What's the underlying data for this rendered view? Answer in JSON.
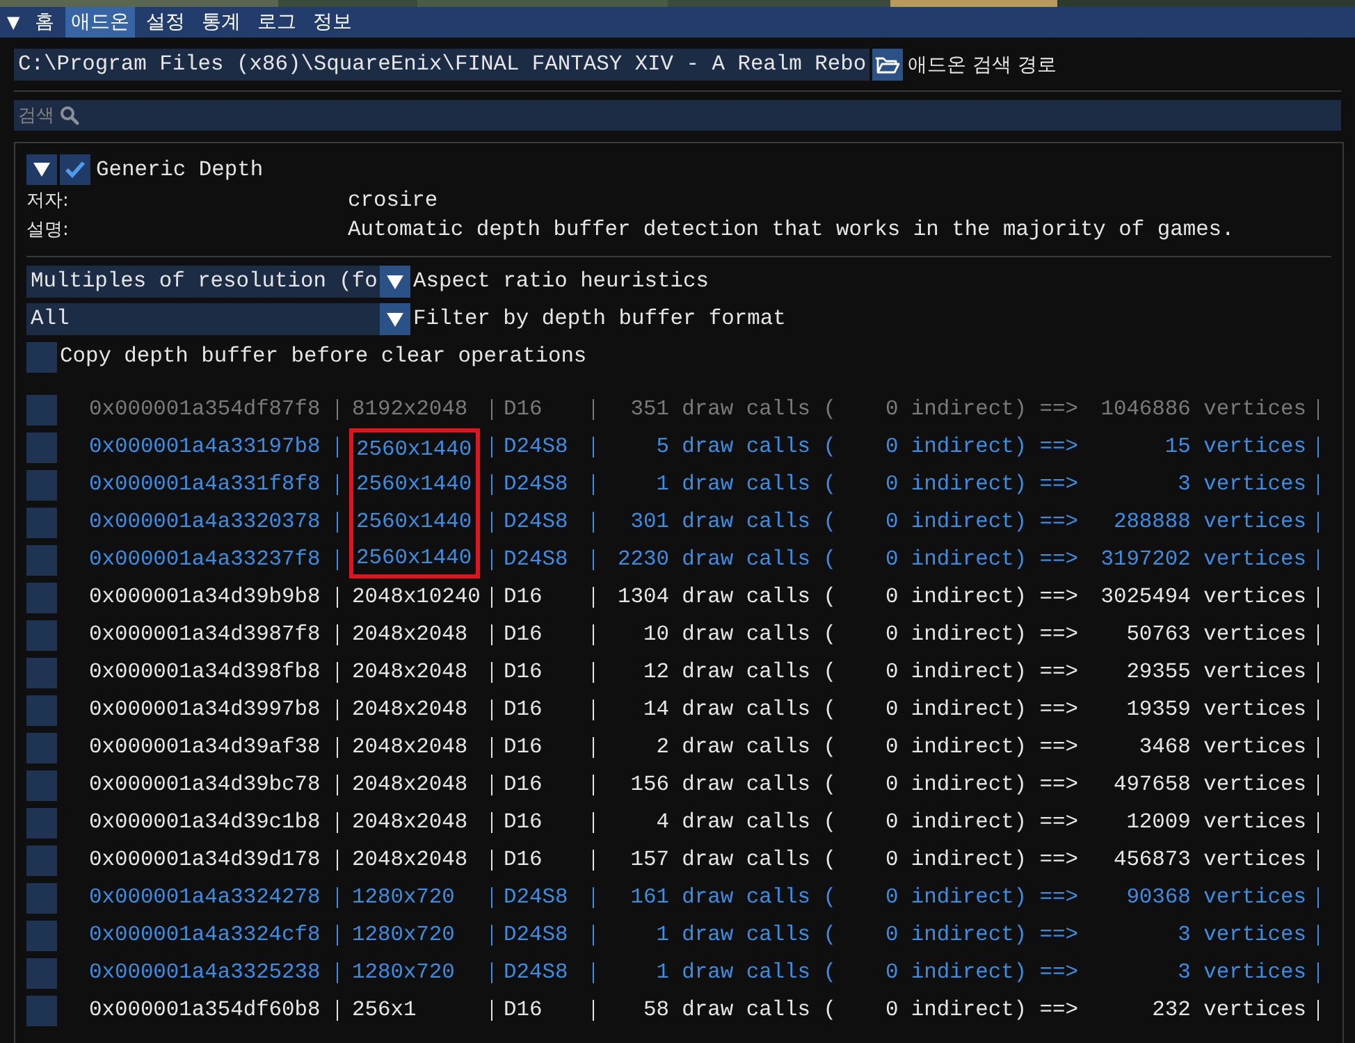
{
  "menu": {
    "toggle": "▼",
    "tabs": [
      {
        "label": "홈",
        "selected": false
      },
      {
        "label": "애드온",
        "selected": true
      },
      {
        "label": "설정",
        "selected": false
      },
      {
        "label": "통계",
        "selected": false
      },
      {
        "label": "로그",
        "selected": false
      },
      {
        "label": "정보",
        "selected": false
      }
    ]
  },
  "path_field": {
    "value": "C:\\Program Files (x86)\\SquareEnix\\FINAL FANTASY XIV - A Realm Rebo",
    "label": "애드온 검색 경로"
  },
  "search": {
    "placeholder": "검색"
  },
  "addon": {
    "expanded": true,
    "enabled": true,
    "name": "Generic Depth",
    "info": [
      {
        "label": "저자:",
        "value": "crosire"
      },
      {
        "label": "설명:",
        "value": "Automatic depth buffer detection that works in the majority of games."
      }
    ],
    "settings": [
      {
        "kind": "combo",
        "selected_option": "Multiples of resolution (fo",
        "label": "Aspect ratio heuristics"
      },
      {
        "kind": "combo",
        "selected_option": "All",
        "label": "Filter by depth buffer format"
      },
      {
        "kind": "checkbox",
        "checked": false,
        "label": "Copy depth buffer before clear operations"
      }
    ],
    "buffers": [
      {
        "kind": "dimmed",
        "checked": false,
        "highlighted": false,
        "address": "0x000001a354df87f8",
        "resolution": "8192x2048",
        "format": "D16",
        "draw_calls": "351 draw calls (",
        "indirect": "0 indirect) ==>",
        "vertices": "1046886 vertices"
      },
      {
        "kind": "blue",
        "checked": false,
        "highlighted": true,
        "address": "0x000001a4a33197b8",
        "resolution": "2560x1440",
        "format": "D24S8",
        "draw_calls": "5 draw calls (",
        "indirect": "0 indirect) ==>",
        "vertices": "15 vertices"
      },
      {
        "kind": "blue",
        "checked": false,
        "highlighted": true,
        "address": "0x000001a4a331f8f8",
        "resolution": "2560x1440",
        "format": "D24S8",
        "draw_calls": "1 draw calls (",
        "indirect": "0 indirect) ==>",
        "vertices": "3 vertices"
      },
      {
        "kind": "blue",
        "checked": false,
        "highlighted": true,
        "address": "0x000001a4a3320378",
        "resolution": "2560x1440",
        "format": "D24S8",
        "draw_calls": "301 draw calls (",
        "indirect": "0 indirect) ==>",
        "vertices": "288888 vertices"
      },
      {
        "kind": "blue",
        "checked": false,
        "highlighted": true,
        "address": "0x000001a4a33237f8",
        "resolution": "2560x1440",
        "format": "D24S8",
        "draw_calls": "2230 draw calls (",
        "indirect": "0 indirect) ==>",
        "vertices": "3197202 vertices"
      },
      {
        "kind": "normal",
        "checked": false,
        "highlighted": false,
        "address": "0x000001a34d39b9b8",
        "resolution": "2048x10240",
        "format": "D16",
        "draw_calls": "1304 draw calls (",
        "indirect": "0 indirect) ==>",
        "vertices": "3025494 vertices"
      },
      {
        "kind": "normal",
        "checked": false,
        "highlighted": false,
        "address": "0x000001a34d3987f8",
        "resolution": "2048x2048",
        "format": "D16",
        "draw_calls": "10 draw calls (",
        "indirect": "0 indirect) ==>",
        "vertices": "50763 vertices"
      },
      {
        "kind": "normal",
        "checked": false,
        "highlighted": false,
        "address": "0x000001a34d398fb8",
        "resolution": "2048x2048",
        "format": "D16",
        "draw_calls": "12 draw calls (",
        "indirect": "0 indirect) ==>",
        "vertices": "29355 vertices"
      },
      {
        "kind": "normal",
        "checked": false,
        "highlighted": false,
        "address": "0x000001a34d3997b8",
        "resolution": "2048x2048",
        "format": "D16",
        "draw_calls": "14 draw calls (",
        "indirect": "0 indirect) ==>",
        "vertices": "19359 vertices"
      },
      {
        "kind": "normal",
        "checked": false,
        "highlighted": false,
        "address": "0x000001a34d39af38",
        "resolution": "2048x2048",
        "format": "D16",
        "draw_calls": "2 draw calls (",
        "indirect": "0 indirect) ==>",
        "vertices": "3468 vertices"
      },
      {
        "kind": "normal",
        "checked": false,
        "highlighted": false,
        "address": "0x000001a34d39bc78",
        "resolution": "2048x2048",
        "format": "D16",
        "draw_calls": "156 draw calls (",
        "indirect": "0 indirect) ==>",
        "vertices": "497658 vertices"
      },
      {
        "kind": "normal",
        "checked": false,
        "highlighted": false,
        "address": "0x000001a34d39c1b8",
        "resolution": "2048x2048",
        "format": "D16",
        "draw_calls": "4 draw calls (",
        "indirect": "0 indirect) ==>",
        "vertices": "12009 vertices"
      },
      {
        "kind": "normal",
        "checked": false,
        "highlighted": false,
        "address": "0x000001a34d39d178",
        "resolution": "2048x2048",
        "format": "D16",
        "draw_calls": "157 draw calls (",
        "indirect": "0 indirect) ==>",
        "vertices": "456873 vertices"
      },
      {
        "kind": "blue",
        "checked": false,
        "highlighted": false,
        "address": "0x000001a4a3324278",
        "resolution": "1280x720",
        "format": "D24S8",
        "draw_calls": "161 draw calls (",
        "indirect": "0 indirect) ==>",
        "vertices": "90368 vertices"
      },
      {
        "kind": "blue",
        "checked": false,
        "highlighted": false,
        "address": "0x000001a4a3324cf8",
        "resolution": "1280x720",
        "format": "D24S8",
        "draw_calls": "1 draw calls (",
        "indirect": "0 indirect) ==>",
        "vertices": "3 vertices"
      },
      {
        "kind": "blue",
        "checked": false,
        "highlighted": false,
        "address": "0x000001a4a3325238",
        "resolution": "1280x720",
        "format": "D24S8",
        "draw_calls": "1 draw calls (",
        "indirect": "0 indirect) ==>",
        "vertices": "3 vertices"
      },
      {
        "kind": "normal",
        "checked": false,
        "highlighted": false,
        "address": "0x000001a354df60b8",
        "resolution": "256x1",
        "format": "D16",
        "draw_calls": "58 draw calls (",
        "indirect": "0 indirect) ==>",
        "vertices": "232 vertices"
      }
    ]
  }
}
